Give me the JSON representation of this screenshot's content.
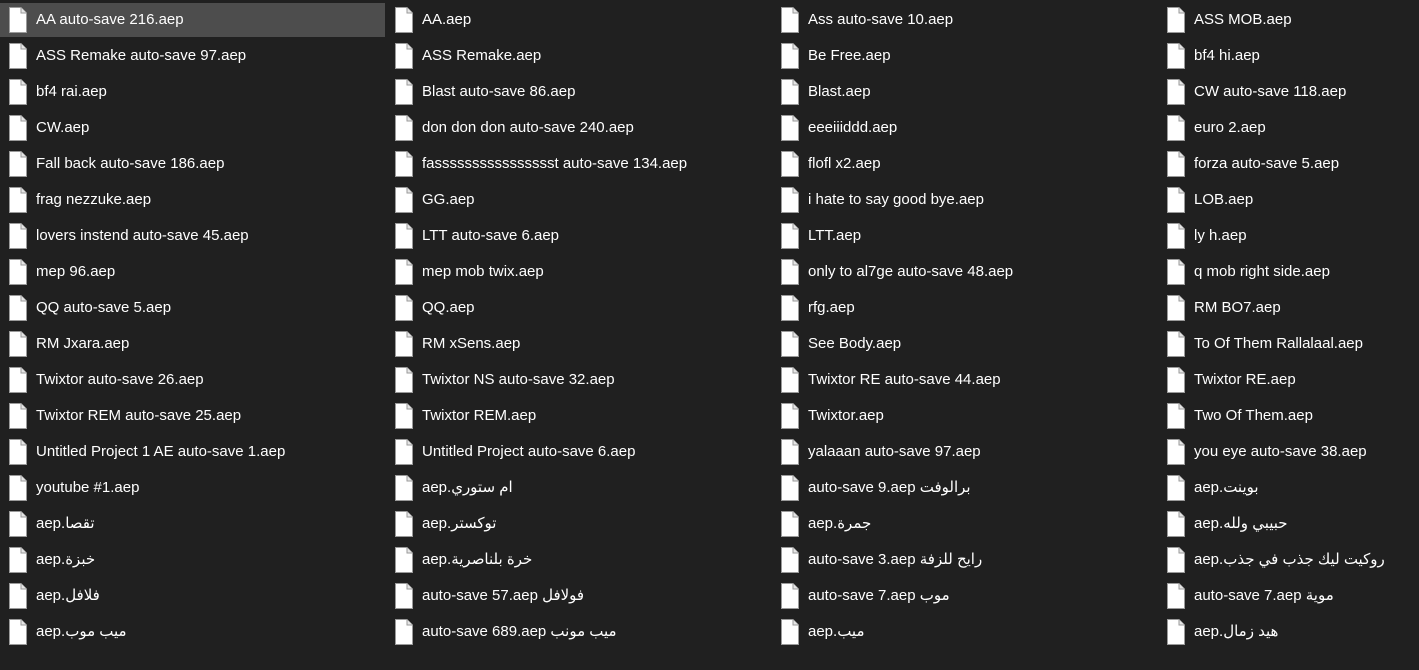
{
  "view": {
    "selected_index": 0,
    "item_icon": "document-icon"
  },
  "files": [
    "AA auto-save 216.aep",
    "ASS Remake auto-save 97.aep",
    "bf4 rai.aep",
    "CW.aep",
    "Fall back auto-save 186.aep",
    "frag nezzuke.aep",
    "lovers instend auto-save 45.aep",
    "mep 96.aep",
    "QQ auto-save 5.aep",
    "RM Jxara.aep",
    "Twixtor auto-save 26.aep",
    "Twixtor REM auto-save 25.aep",
    "Untitled Project 1 AE auto-save 1.aep",
    "youtube #1.aep",
    "تقصا.aep",
    "خبزة.aep",
    "فلافل.aep",
    "ميب موب.aep",
    "AA.aep",
    "ASS Remake.aep",
    "Blast auto-save 86.aep",
    "don don don auto-save 240.aep",
    "fasssssssssssssssst auto-save 134.aep",
    "GG.aep",
    "LTT auto-save 6.aep",
    "mep mob twix.aep",
    "QQ.aep",
    "RM xSens.aep",
    "Twixtor NS auto-save 32.aep",
    "Twixtor REM.aep",
    "Untitled Project auto-save 6.aep",
    "ام ستوري.aep",
    "توكستر.aep",
    "خرة بلناصرية.aep",
    "فولافل auto-save 57.aep",
    "ميب مونب auto-save 689.aep",
    "Ass auto-save 10.aep",
    "Be Free.aep",
    "Blast.aep",
    "eeeiiiddd.aep",
    "flofl x2.aep",
    "i hate to say good bye.aep",
    "LTT.aep",
    "only to al7ge auto-save 48.aep",
    "rfg.aep",
    "See Body.aep",
    "Twixtor RE auto-save 44.aep",
    "Twixtor.aep",
    "yalaaan auto-save 97.aep",
    "برالوفت auto-save 9.aep",
    "جمرة.aep",
    "رايح للزفة auto-save 3.aep",
    "موب auto-save 7.aep",
    "ميب.aep",
    "ASS MOB.aep",
    "bf4 hi.aep",
    "CW auto-save 118.aep",
    "euro 2.aep",
    "forza auto-save 5.aep",
    "LOB.aep",
    "ly h.aep",
    "q mob right side.aep",
    "RM BO7.aep",
    "To Of Them Rallalaal.aep",
    "Twixtor RE.aep",
    "Two Of Them.aep",
    "you eye auto-save 38.aep",
    "بوينت.aep",
    "حبيبي ولله.aep",
    "روكيت ليك جذب في جذب.aep",
    "موية auto-save 7.aep",
    "هيد زمال.aep"
  ]
}
